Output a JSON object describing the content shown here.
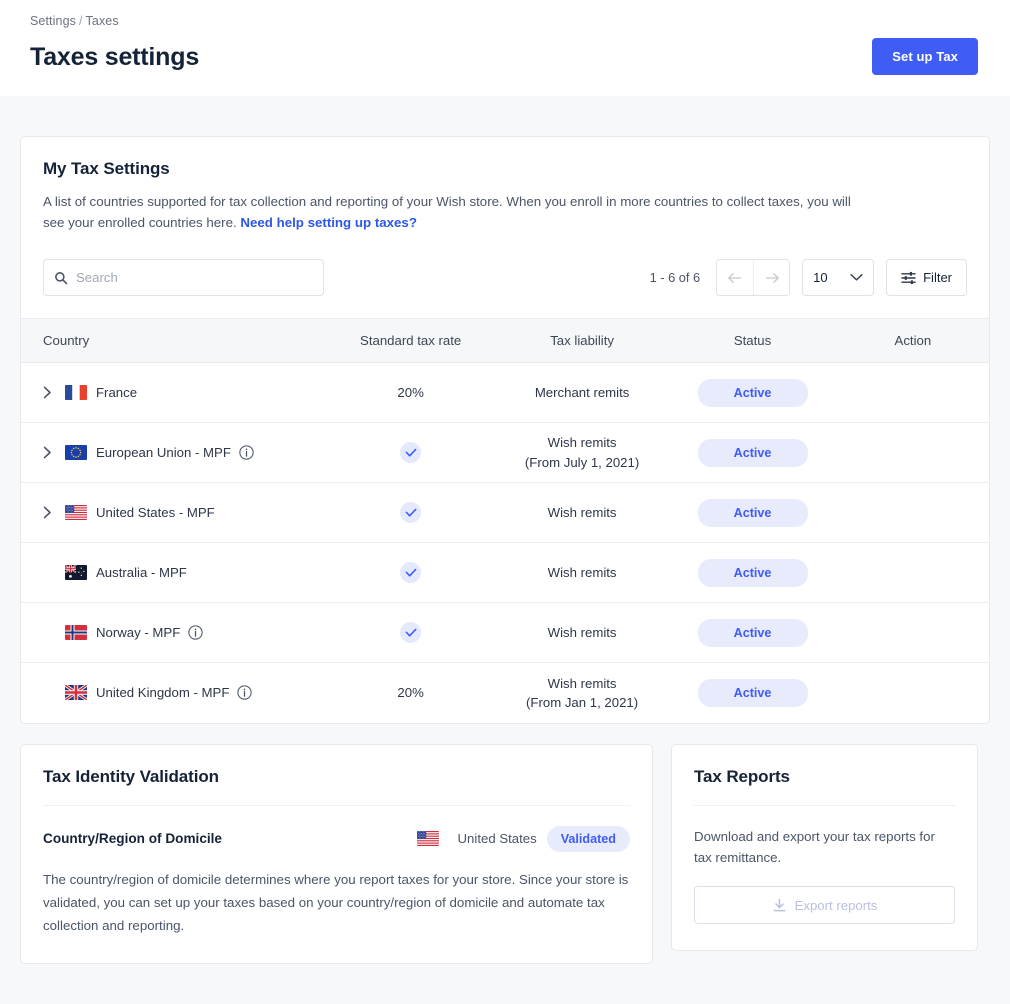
{
  "header": {
    "breadcrumb": {
      "parent": "Settings",
      "separator": "/",
      "current": "Taxes"
    },
    "title": "Taxes settings",
    "setup_button": "Set up Tax",
    "accent_color": "#3f5cf5"
  },
  "my_tax_settings": {
    "title": "My Tax Settings",
    "description_part1": "A list of countries supported for tax collection and reporting of your Wish store. When you enroll in more countries to collect taxes, you will see your enrolled countries here. ",
    "help_link": "Need help setting up taxes?",
    "toolbar": {
      "search_placeholder": "Search",
      "search_value": "",
      "range_label": "1 - 6 of 6",
      "per_page_value": "10",
      "filter_label": "Filter"
    },
    "columns": [
      "Country",
      "Standard tax rate",
      "Tax liability",
      "Status",
      "Action"
    ],
    "rows": [
      {
        "country": "France",
        "flag": "fr-flag-icon",
        "expandable": true,
        "has_info": false,
        "rate_text": "20%",
        "rate_is_check": false,
        "liability": "Merchant remits",
        "liability_sub": "",
        "status": "Active",
        "action": ""
      },
      {
        "country": "European Union - MPF",
        "flag": "eu-flag-icon",
        "expandable": true,
        "has_info": true,
        "rate_text": "",
        "rate_is_check": true,
        "liability": "Wish remits",
        "liability_sub": "(From July 1, 2021)",
        "status": "Active",
        "action": ""
      },
      {
        "country": "United States - MPF",
        "flag": "us-flag-icon",
        "expandable": true,
        "has_info": false,
        "rate_text": "",
        "rate_is_check": true,
        "liability": "Wish remits",
        "liability_sub": "",
        "status": "Active",
        "action": ""
      },
      {
        "country": "Australia - MPF",
        "flag": "au-flag-icon",
        "expandable": false,
        "has_info": false,
        "rate_text": "",
        "rate_is_check": true,
        "liability": "Wish remits",
        "liability_sub": "",
        "status": "Active",
        "action": ""
      },
      {
        "country": "Norway - MPF",
        "flag": "no-flag-icon",
        "expandable": false,
        "has_info": true,
        "rate_text": "",
        "rate_is_check": true,
        "liability": "Wish remits",
        "liability_sub": "",
        "status": "Active",
        "action": ""
      },
      {
        "country": "United Kingdom - MPF",
        "flag": "gb-flag-icon",
        "expandable": false,
        "has_info": true,
        "rate_text": "20%",
        "rate_is_check": false,
        "liability": "Wish remits",
        "liability_sub": "(From Jan 1, 2021)",
        "status": "Active",
        "action": ""
      }
    ],
    "status_badge_bg": "#e7ebfc",
    "status_badge_color": "#3f5cf5"
  },
  "tax_identity_validation": {
    "title": "Tax Identity Validation",
    "domicile_label": "Country/Region of Domicile",
    "domicile_country": "United States",
    "domicile_flag": "us-flag-icon",
    "domicile_badge": "Validated",
    "body": "The country/region of domicile determines where you report taxes for your store. Since your store is validated, you can set up your taxes based on your country/region of domicile and automate tax collection and reporting."
  },
  "tax_reports": {
    "title": "Tax Reports",
    "body": "Download and export your tax reports for tax remittance.",
    "export_button": "Export reports",
    "export_disabled": true
  }
}
